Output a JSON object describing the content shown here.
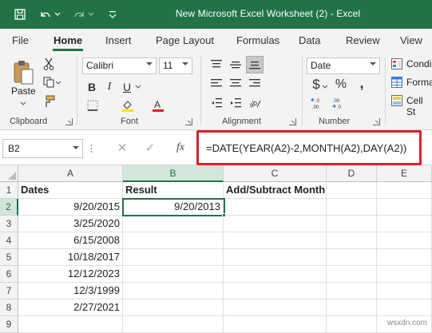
{
  "titlebar": {
    "title": "New Microsoft Excel Worksheet (2)  -  Excel",
    "icons": [
      "save-icon",
      "undo-icon",
      "redo-icon"
    ]
  },
  "tabs": [
    "File",
    "Home",
    "Insert",
    "Page Layout",
    "Formulas",
    "Data",
    "Review",
    "View"
  ],
  "active_tab": "Home",
  "ribbon": {
    "clipboard": {
      "paste_label": "Paste",
      "group_label": "Clipboard"
    },
    "font": {
      "name": "Calibri",
      "size": "11",
      "group_label": "Font"
    },
    "alignment": {
      "group_label": "Alignment"
    },
    "number": {
      "format": "Date",
      "currency": "$",
      "percent": "%",
      "comma": ",",
      "group_label": "Number"
    },
    "styles": {
      "conditional": "Condi",
      "format_table": "Forma",
      "cell_styles": "Cell St"
    }
  },
  "formula_bar": {
    "name_box": "B2",
    "formula": "=DATE(YEAR(A2)-2,MONTH(A2),DAY(A2))",
    "fx": "fx"
  },
  "grid": {
    "columns": [
      "A",
      "B",
      "C",
      "D",
      "E"
    ],
    "rows": [
      "1",
      "2",
      "3",
      "4",
      "5",
      "6",
      "7",
      "8",
      "9"
    ],
    "headers": {
      "a": "Dates",
      "b": "Result",
      "c": "Add/Subtract Month"
    },
    "dates": [
      "9/20/2015",
      "3/25/2020",
      "6/15/2008",
      "10/18/2017",
      "12/12/2023",
      "12/3/1999",
      "2/27/2021"
    ],
    "result": "9/20/2013"
  },
  "watermark": "wsxdn.com",
  "colors": {
    "accent": "#217346",
    "highlight": "#d9202a"
  }
}
